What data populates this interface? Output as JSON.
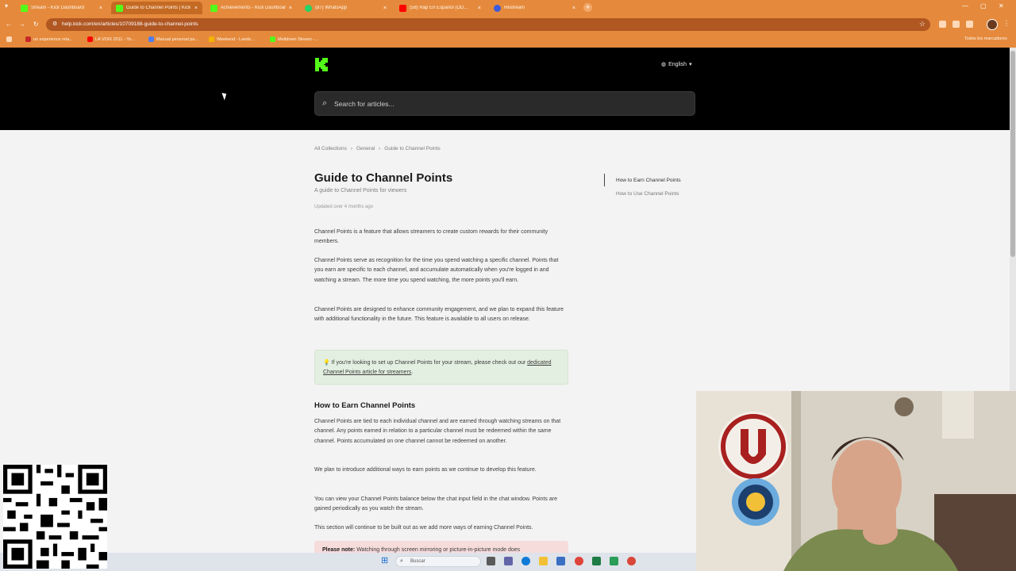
{
  "browser": {
    "tabs": [
      {
        "title": "Stream - Kick Dashboard",
        "favicon_color": "#53fc18",
        "active": false
      },
      {
        "title": "Guide to Channel Points | Kick",
        "favicon_color": "#53fc18",
        "active": true
      },
      {
        "title": "Achievements - Kick Dashboard",
        "favicon_color": "#53fc18",
        "active": false
      },
      {
        "title": "(87) WhatsApp",
        "favicon_color": "#25d366",
        "active": false
      },
      {
        "title": "(58) Rap En Español (OD...",
        "favicon_color": "#ff0000",
        "active": false
      },
      {
        "title": "Restream",
        "favicon_color": "#3b5bdb",
        "active": false
      }
    ],
    "new_tab": "+",
    "url": "help.kick.com/en/articles/10709188-guide-to-channel-points",
    "bookmarks": [
      {
        "label": "un experience rela...",
        "color": "#c62828"
      },
      {
        "label": "LA VOIX 2011 - Yo...",
        "color": "#ff0000"
      },
      {
        "label": "Manual personal pa...",
        "color": "#4f7cf0"
      },
      {
        "label": "Weekend - Leeds...",
        "color": "#f5b400"
      },
      {
        "label": "Meltdown Stream -...",
        "color": "#53fc18"
      }
    ],
    "all_bookmarks": "Todos los marcadores"
  },
  "header": {
    "language": "English",
    "search_placeholder": "Search for articles..."
  },
  "breadcrumb": [
    "All Collections",
    "General",
    "Guide to Channel Points"
  ],
  "article": {
    "title": "Guide to Channel Points",
    "subtitle": "A guide to Channel Points for viewers",
    "updated": "Updated over 4 months ago",
    "p1": "Channel Points is a feature that allows streamers to create custom rewards for their community members.",
    "p2": "Channel Points serve as recognition for the time you spend watching a specific channel. Points that you earn are specific to each channel, and accumulate automatically when you're logged in and watching a stream. The more time you spend watching, the more points you'll earn.",
    "p3": "Channel Points are designed to enhance community engagement, and we plan to expand this feature with additional functionality in the future. This feature is available to all users on release.",
    "callout_prefix": "💡 If you're looking to set up Channel Points for your stream, please check out our",
    "callout_link": "dedicated Channel Points article for streamers",
    "callout_suffix": ".",
    "h2": "How to Earn Channel Points",
    "p4": "Channel Points are tied to each individual channel and are earned through watching streams on that channel. Any points earned in relation to a particular channel must be redeemed within the same channel. Points accumulated on one channel cannot be redeemed on another.",
    "p5": "We plan to introduce additional ways to earn points as we continue to develop this feature.",
    "p6": "You can view your Channel Points balance below the chat input field in the chat window. Points are gained periodically as you watch the stream.",
    "p7": "This section will continue to be built out as we add more ways of earning Channel Points.",
    "note_label": "Please note:",
    "note_text": "Watching through screen mirroring or picture-in-picture mode does"
  },
  "toc": [
    "How to Earn Channel Points",
    "How to Use Channel Points"
  ],
  "taskbar": {
    "search_label": "Buscar"
  }
}
